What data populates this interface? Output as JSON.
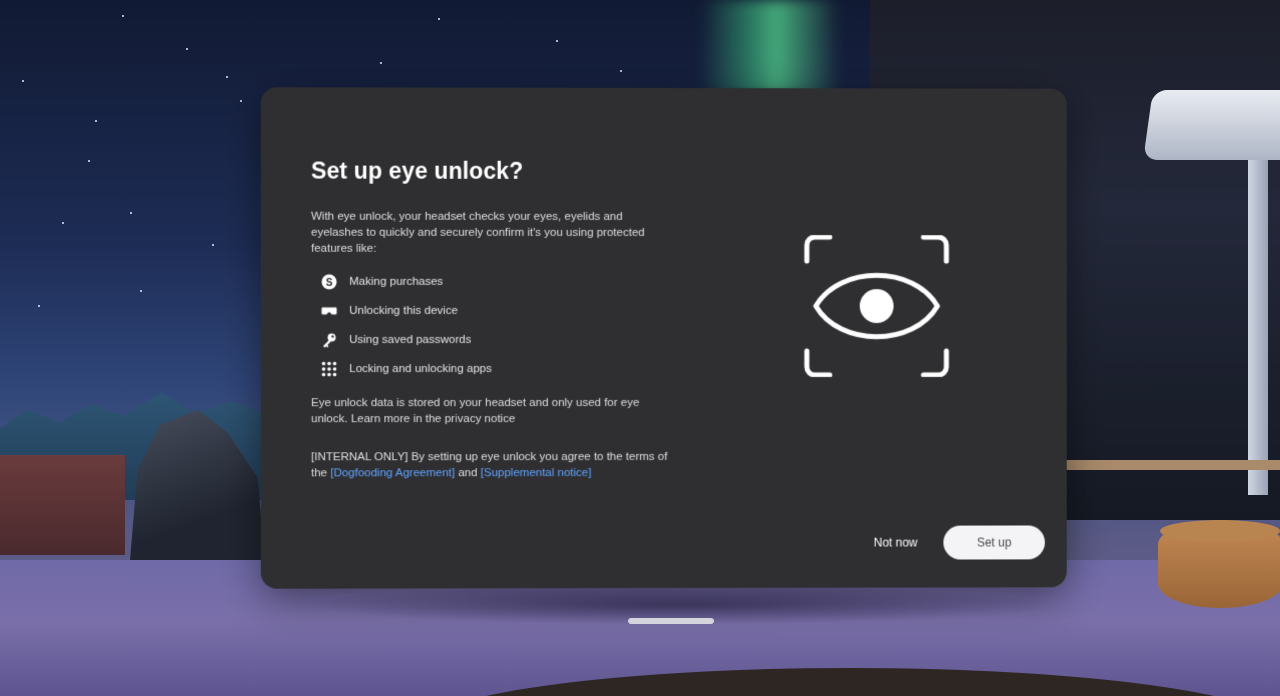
{
  "dialog": {
    "title": "Set up eye unlock?",
    "intro": "With eye unlock, your headset checks your eyes, eyelids and eyelashes to quickly and securely confirm it's you using protected features like:",
    "features": [
      {
        "icon": "dollar-coin-icon",
        "label": "Making purchases"
      },
      {
        "icon": "headset-icon",
        "label": "Unlocking this device"
      },
      {
        "icon": "key-icon",
        "label": "Using saved passwords"
      },
      {
        "icon": "app-grid-icon",
        "label": "Locking and unlocking apps"
      }
    ],
    "storage_note": "Eye unlock data is stored on your headset and only used for eye unlock. Learn more in the privacy notice",
    "agreement": {
      "prefix": "[INTERNAL ONLY] By setting up eye unlock you agree to the terms of the ",
      "link1": "[Dogfooding Agreement]",
      "middle": " and ",
      "link2": "[Supplemental notice]"
    },
    "illustration_icon": "eye-scan-icon",
    "buttons": {
      "secondary": "Not now",
      "primary": "Set up"
    }
  },
  "colors": {
    "panel": "#2f2f31",
    "link": "#5fa2ff",
    "primary_button": "#f4f4f6"
  }
}
